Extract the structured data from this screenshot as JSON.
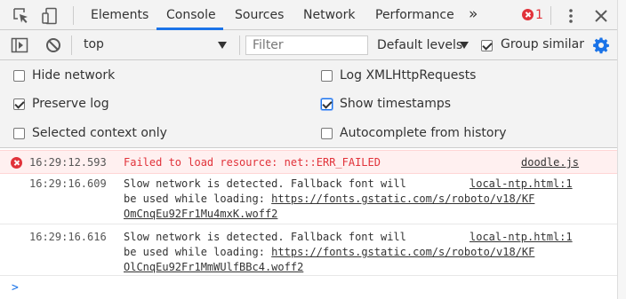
{
  "tabs": [
    {
      "label": "Elements"
    },
    {
      "label": "Console",
      "active": true
    },
    {
      "label": "Sources"
    },
    {
      "label": "Network"
    },
    {
      "label": "Performance"
    }
  ],
  "overflow_glyph": "»",
  "error_count": "1",
  "toolbar": {
    "context_value": "top",
    "filter_placeholder": "Filter",
    "levels_label": "Default levels",
    "group_similar_label": "Group similar",
    "group_similar_checked": true
  },
  "settings": {
    "left": [
      {
        "label": "Hide network",
        "checked": false
      },
      {
        "label": "Preserve log",
        "checked": true
      },
      {
        "label": "Selected context only",
        "checked": false
      }
    ],
    "right": [
      {
        "label": "Log XMLHttpRequests",
        "checked": false
      },
      {
        "label": "Show timestamps",
        "checked": true
      },
      {
        "label": "Autocomplete from history",
        "checked": false
      }
    ]
  },
  "messages": [
    {
      "level": "error",
      "timestamp": "16:29:12.593",
      "lines": [
        "Failed to load resource: net::ERR_FAILED"
      ],
      "source": "doodle.js"
    },
    {
      "level": "info",
      "timestamp": "16:29:16.609",
      "lines": [
        "Slow network is detected. Fallback font will",
        "be used while loading: "
      ],
      "url_part1": "https://fonts.gstatic.com/s/roboto/v18/KF",
      "url_part2": "OmCnqEu92Fr1Mu4mxK.woff2",
      "source": "local-ntp.html:1"
    },
    {
      "level": "info",
      "timestamp": "16:29:16.616",
      "lines": [
        "Slow network is detected. Fallback font will",
        "be used while loading: "
      ],
      "url_part1": "https://fonts.gstatic.com/s/roboto/v18/KF",
      "url_part2": "OlCnqEu92Fr1MmWUlfBBc4.woff2",
      "source": "local-ntp.html:1"
    }
  ],
  "prompt_glyph": ">",
  "colors": {
    "accent": "#1a73e8",
    "error": "#e1323a",
    "error_bg": "#fff0f0"
  }
}
